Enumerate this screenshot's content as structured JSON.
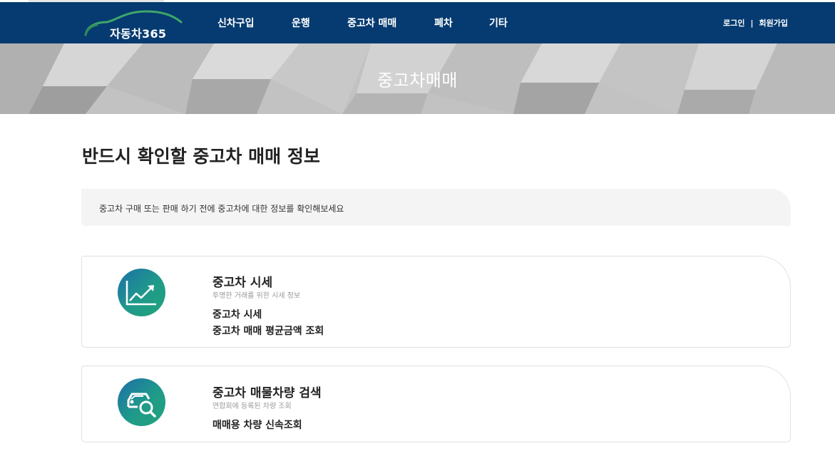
{
  "header": {
    "logo_text": "자동차365",
    "nav": [
      "신차구입",
      "운행",
      "중고차 매매",
      "폐차",
      "기타"
    ],
    "login": "로그인",
    "separator": "|",
    "signup": "회원가입"
  },
  "banner": {
    "title": "중고차매매"
  },
  "main": {
    "title": "반드시 확인할 중고차 매매 정보",
    "notice": "중고차 구매 또는 판매 하기 전에 중고차에 대한 정보를 확인해보세요",
    "cards": [
      {
        "icon": "trend-chart-icon",
        "title": "중고차 시세",
        "subtitle": "투명한 거래를 위한 시세 정보",
        "lines": [
          "중고차 시세",
          "중고차 매매 평균금액 조회"
        ]
      },
      {
        "icon": "car-search-icon",
        "title": "중고차 매물차량 검색",
        "subtitle": "연합회에 등록된 차량 조회",
        "lines": [
          "매매용 차량 신속조회"
        ]
      }
    ]
  },
  "colors": {
    "header_bg": "#053b70",
    "icon_gradient_start": "#1e6fa8",
    "icon_gradient_end": "#22a37a",
    "logo_arc": "#3fa66b"
  }
}
